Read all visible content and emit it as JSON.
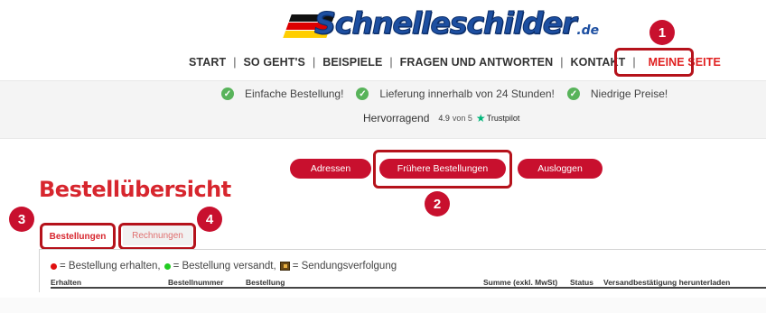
{
  "brand": {
    "name": "Schnelleschilder",
    "tld": ".de",
    "flag_colors": [
      "#111111",
      "#dd0000",
      "#ffce00"
    ]
  },
  "nav": {
    "items": [
      {
        "label": "START"
      },
      {
        "label": "SO GEHT'S"
      },
      {
        "label": "BEISPIELE"
      },
      {
        "label": "FRAGEN UND ANTWORTEN"
      },
      {
        "label": "KONTAKT"
      },
      {
        "label": "MEINE SEITE"
      }
    ],
    "separator": "|"
  },
  "usps": [
    {
      "icon": "check-circle-icon",
      "text": "Einfache Bestellung!"
    },
    {
      "icon": "check-circle-icon",
      "text": "Lieferung innerhalb von 24 Stunden!"
    },
    {
      "icon": "check-circle-icon",
      "text": "Niedrige Preise!"
    }
  ],
  "trustpilot": {
    "label": "Hervorragend",
    "score": "4.9",
    "von": "von 5",
    "brand": "Trustpilot",
    "icon": "trustpilot-star-icon"
  },
  "actions": {
    "adressen": "Adressen",
    "fruehere": "Frühere Bestellungen",
    "ausloggen": "Ausloggen"
  },
  "page": {
    "title": "Bestellübersicht"
  },
  "tabs": {
    "bestellungen": "Bestellungen",
    "rechnungen": "Rechnungen"
  },
  "legend": {
    "received": "= Bestellung erhalten,",
    "shipped": "= Bestellung versandt,",
    "tracking": "= Sendungsverfolgung",
    "received_color": "#e01010",
    "shipped_color": "#22cc22"
  },
  "table": {
    "headers": {
      "erhalten": "Erhalten",
      "bestellnummer": "Bestellnummer",
      "bestellung": "Bestellung",
      "summe": "Summe (exkl. MwSt)",
      "status": "Status",
      "versand": "Versandbestätigung herunterladen"
    }
  },
  "annotations": {
    "one": "1",
    "two": "2",
    "three": "3",
    "four": "4"
  },
  "colors": {
    "accent": "#c8102e",
    "heading": "#d7262e",
    "check": "#58b35a",
    "trustpilot": "#00b67a"
  }
}
